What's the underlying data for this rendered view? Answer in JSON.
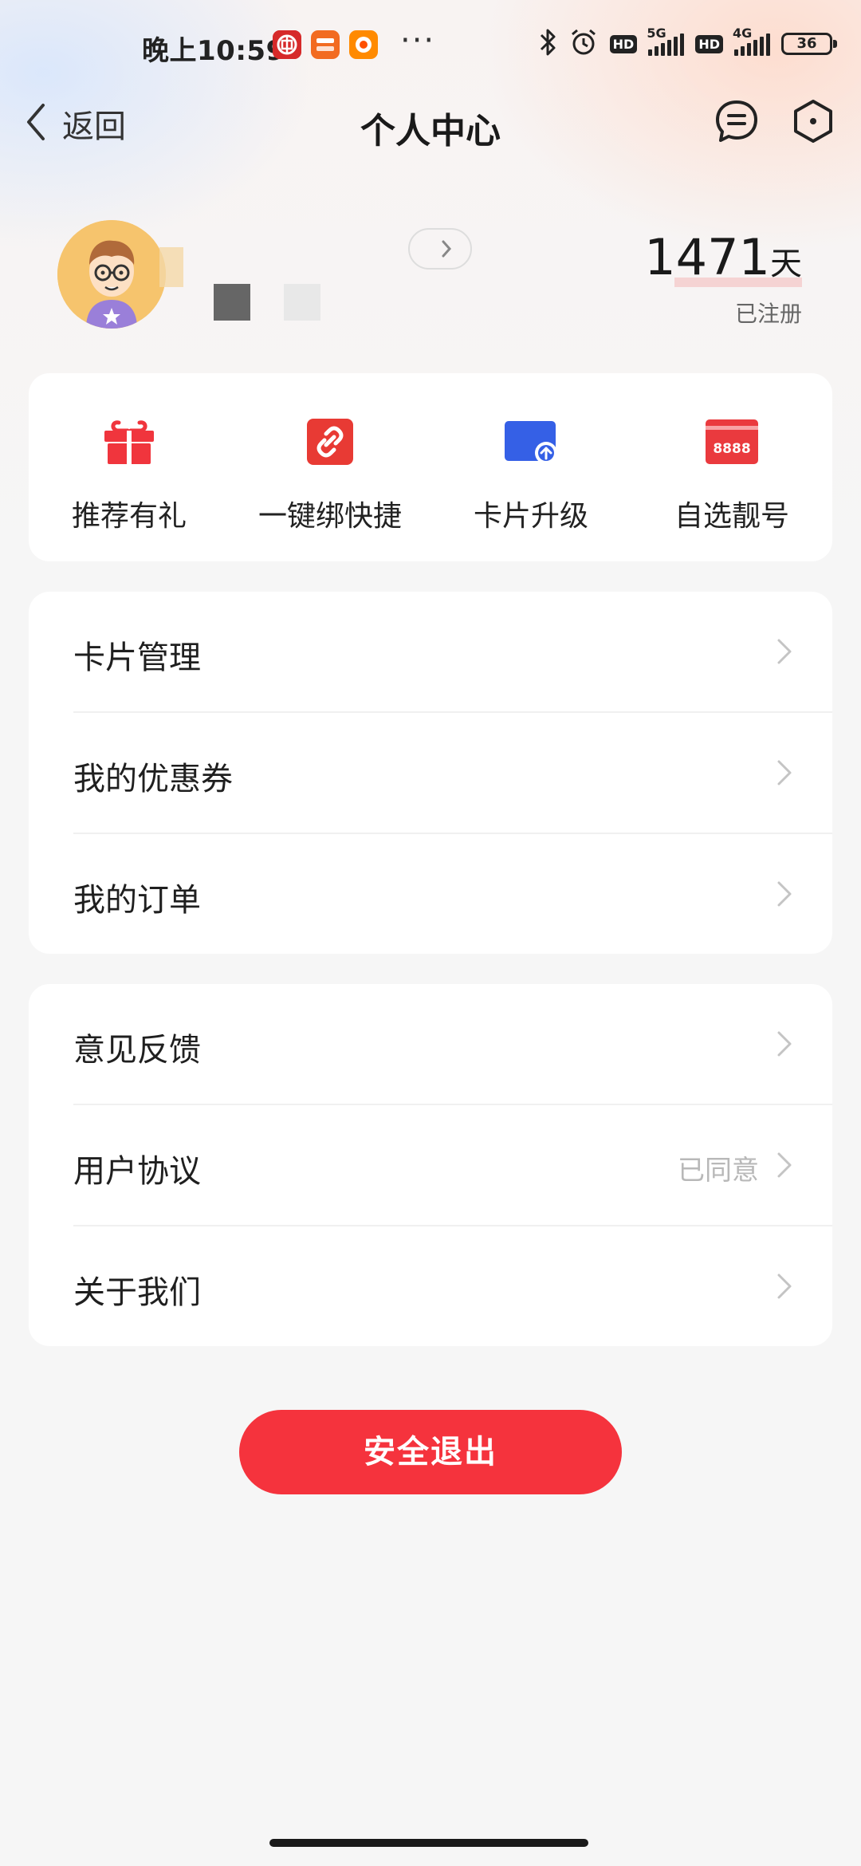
{
  "status_bar": {
    "time": "晚上10:59",
    "dots": "···",
    "hd": "HD",
    "net1": "5G",
    "net2": "4G",
    "battery": "36",
    "app_icons": [
      "bank-of-china-icon",
      "ping-an-bank-icon",
      "taobao-icon"
    ]
  },
  "header": {
    "back_label": "返回",
    "title": "个人中心"
  },
  "profile": {
    "days_value": "1471",
    "days_unit": "天",
    "days_label": "已注册"
  },
  "quick_actions": [
    {
      "label": "推荐有礼",
      "icon": "gift-icon",
      "color": "#f0353d"
    },
    {
      "label": "一键绑快捷",
      "icon": "link-icon",
      "color": "#e83a34"
    },
    {
      "label": "卡片升级",
      "icon": "card-upgrade-icon",
      "color": "#3560e6"
    },
    {
      "label": "自选靓号",
      "icon": "number-card-icon",
      "color": "#ea3a3e",
      "icon_text": "8888"
    }
  ],
  "menu_group_1": [
    {
      "label": "卡片管理"
    },
    {
      "label": "我的优惠券"
    },
    {
      "label": "我的订单"
    }
  ],
  "menu_group_2": [
    {
      "label": "意见反馈"
    },
    {
      "label": "用户协议",
      "value": "已同意"
    },
    {
      "label": "关于我们"
    }
  ],
  "logout_label": "安全退出",
  "colors": {
    "accent": "#f5333d",
    "background": "#f6f6f6",
    "card": "#ffffff"
  }
}
